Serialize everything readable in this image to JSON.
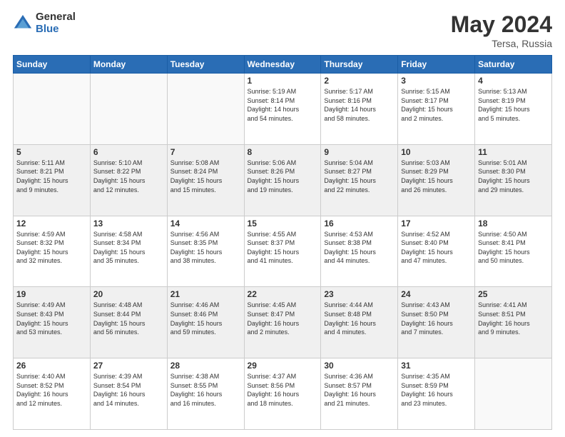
{
  "header": {
    "logo_general": "General",
    "logo_blue": "Blue",
    "title": "May 2024",
    "location": "Tersa, Russia"
  },
  "weekdays": [
    "Sunday",
    "Monday",
    "Tuesday",
    "Wednesday",
    "Thursday",
    "Friday",
    "Saturday"
  ],
  "weeks": [
    [
      {
        "day": "",
        "info": ""
      },
      {
        "day": "",
        "info": ""
      },
      {
        "day": "",
        "info": ""
      },
      {
        "day": "1",
        "info": "Sunrise: 5:19 AM\nSunset: 8:14 PM\nDaylight: 14 hours\nand 54 minutes."
      },
      {
        "day": "2",
        "info": "Sunrise: 5:17 AM\nSunset: 8:16 PM\nDaylight: 14 hours\nand 58 minutes."
      },
      {
        "day": "3",
        "info": "Sunrise: 5:15 AM\nSunset: 8:17 PM\nDaylight: 15 hours\nand 2 minutes."
      },
      {
        "day": "4",
        "info": "Sunrise: 5:13 AM\nSunset: 8:19 PM\nDaylight: 15 hours\nand 5 minutes."
      }
    ],
    [
      {
        "day": "5",
        "info": "Sunrise: 5:11 AM\nSunset: 8:21 PM\nDaylight: 15 hours\nand 9 minutes."
      },
      {
        "day": "6",
        "info": "Sunrise: 5:10 AM\nSunset: 8:22 PM\nDaylight: 15 hours\nand 12 minutes."
      },
      {
        "day": "7",
        "info": "Sunrise: 5:08 AM\nSunset: 8:24 PM\nDaylight: 15 hours\nand 15 minutes."
      },
      {
        "day": "8",
        "info": "Sunrise: 5:06 AM\nSunset: 8:26 PM\nDaylight: 15 hours\nand 19 minutes."
      },
      {
        "day": "9",
        "info": "Sunrise: 5:04 AM\nSunset: 8:27 PM\nDaylight: 15 hours\nand 22 minutes."
      },
      {
        "day": "10",
        "info": "Sunrise: 5:03 AM\nSunset: 8:29 PM\nDaylight: 15 hours\nand 26 minutes."
      },
      {
        "day": "11",
        "info": "Sunrise: 5:01 AM\nSunset: 8:30 PM\nDaylight: 15 hours\nand 29 minutes."
      }
    ],
    [
      {
        "day": "12",
        "info": "Sunrise: 4:59 AM\nSunset: 8:32 PM\nDaylight: 15 hours\nand 32 minutes."
      },
      {
        "day": "13",
        "info": "Sunrise: 4:58 AM\nSunset: 8:34 PM\nDaylight: 15 hours\nand 35 minutes."
      },
      {
        "day": "14",
        "info": "Sunrise: 4:56 AM\nSunset: 8:35 PM\nDaylight: 15 hours\nand 38 minutes."
      },
      {
        "day": "15",
        "info": "Sunrise: 4:55 AM\nSunset: 8:37 PM\nDaylight: 15 hours\nand 41 minutes."
      },
      {
        "day": "16",
        "info": "Sunrise: 4:53 AM\nSunset: 8:38 PM\nDaylight: 15 hours\nand 44 minutes."
      },
      {
        "day": "17",
        "info": "Sunrise: 4:52 AM\nSunset: 8:40 PM\nDaylight: 15 hours\nand 47 minutes."
      },
      {
        "day": "18",
        "info": "Sunrise: 4:50 AM\nSunset: 8:41 PM\nDaylight: 15 hours\nand 50 minutes."
      }
    ],
    [
      {
        "day": "19",
        "info": "Sunrise: 4:49 AM\nSunset: 8:43 PM\nDaylight: 15 hours\nand 53 minutes."
      },
      {
        "day": "20",
        "info": "Sunrise: 4:48 AM\nSunset: 8:44 PM\nDaylight: 15 hours\nand 56 minutes."
      },
      {
        "day": "21",
        "info": "Sunrise: 4:46 AM\nSunset: 8:46 PM\nDaylight: 15 hours\nand 59 minutes."
      },
      {
        "day": "22",
        "info": "Sunrise: 4:45 AM\nSunset: 8:47 PM\nDaylight: 16 hours\nand 2 minutes."
      },
      {
        "day": "23",
        "info": "Sunrise: 4:44 AM\nSunset: 8:48 PM\nDaylight: 16 hours\nand 4 minutes."
      },
      {
        "day": "24",
        "info": "Sunrise: 4:43 AM\nSunset: 8:50 PM\nDaylight: 16 hours\nand 7 minutes."
      },
      {
        "day": "25",
        "info": "Sunrise: 4:41 AM\nSunset: 8:51 PM\nDaylight: 16 hours\nand 9 minutes."
      }
    ],
    [
      {
        "day": "26",
        "info": "Sunrise: 4:40 AM\nSunset: 8:52 PM\nDaylight: 16 hours\nand 12 minutes."
      },
      {
        "day": "27",
        "info": "Sunrise: 4:39 AM\nSunset: 8:54 PM\nDaylight: 16 hours\nand 14 minutes."
      },
      {
        "day": "28",
        "info": "Sunrise: 4:38 AM\nSunset: 8:55 PM\nDaylight: 16 hours\nand 16 minutes."
      },
      {
        "day": "29",
        "info": "Sunrise: 4:37 AM\nSunset: 8:56 PM\nDaylight: 16 hours\nand 18 minutes."
      },
      {
        "day": "30",
        "info": "Sunrise: 4:36 AM\nSunset: 8:57 PM\nDaylight: 16 hours\nand 21 minutes."
      },
      {
        "day": "31",
        "info": "Sunrise: 4:35 AM\nSunset: 8:59 PM\nDaylight: 16 hours\nand 23 minutes."
      },
      {
        "day": "",
        "info": ""
      }
    ]
  ]
}
